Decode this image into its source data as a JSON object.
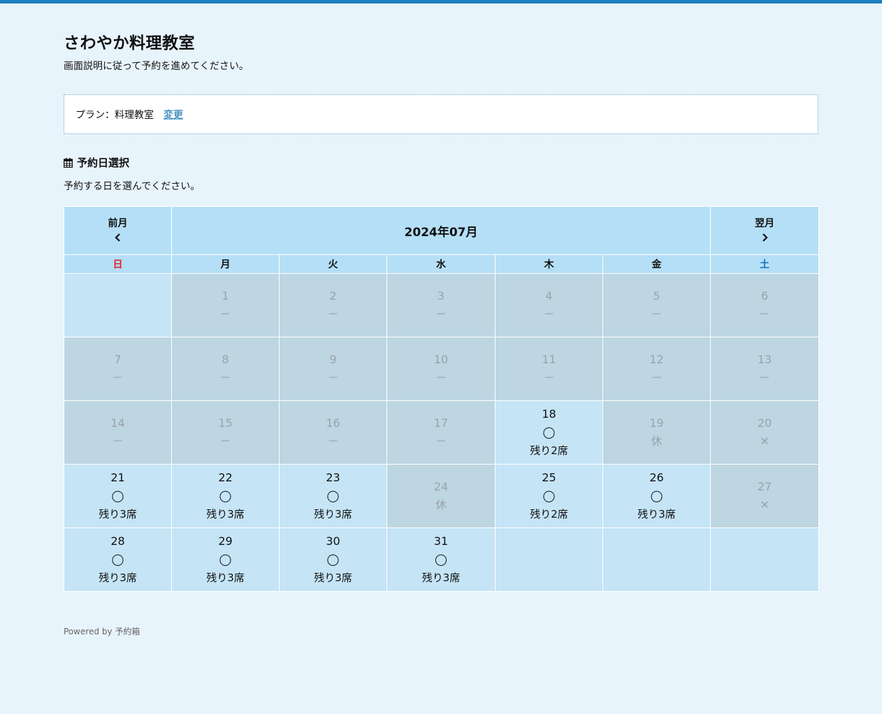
{
  "header": {
    "title": "さわやか料理教室",
    "lead": "画面説明に従って予約を進めてください。"
  },
  "plan": {
    "label": "プラン：料理教室",
    "change_label": "変更"
  },
  "section": {
    "title": "予約日選択",
    "description": "予約する日を選んでください。"
  },
  "calendar": {
    "prev_label": "前月",
    "next_label": "翌月",
    "month_title": "2024年07月",
    "weekdays": [
      "日",
      "月",
      "火",
      "水",
      "木",
      "金",
      "土"
    ],
    "weeks": [
      [
        {
          "day": "",
          "status": "empty"
        },
        {
          "day": "1",
          "mark": "－",
          "status": "off"
        },
        {
          "day": "2",
          "mark": "－",
          "status": "off"
        },
        {
          "day": "3",
          "mark": "－",
          "status": "off"
        },
        {
          "day": "4",
          "mark": "－",
          "status": "off"
        },
        {
          "day": "5",
          "mark": "－",
          "status": "off"
        },
        {
          "day": "6",
          "mark": "－",
          "status": "off"
        }
      ],
      [
        {
          "day": "7",
          "mark": "－",
          "status": "off"
        },
        {
          "day": "8",
          "mark": "－",
          "status": "off"
        },
        {
          "day": "9",
          "mark": "－",
          "status": "off"
        },
        {
          "day": "10",
          "mark": "－",
          "status": "off"
        },
        {
          "day": "11",
          "mark": "－",
          "status": "off"
        },
        {
          "day": "12",
          "mark": "－",
          "status": "off"
        },
        {
          "day": "13",
          "mark": "－",
          "status": "off"
        }
      ],
      [
        {
          "day": "14",
          "mark": "－",
          "status": "off"
        },
        {
          "day": "15",
          "mark": "－",
          "status": "off"
        },
        {
          "day": "16",
          "mark": "－",
          "status": "off"
        },
        {
          "day": "17",
          "mark": "－",
          "status": "off"
        },
        {
          "day": "18",
          "mark": "◯",
          "remaining": "残り2席",
          "status": "open"
        },
        {
          "day": "19",
          "mark": "休",
          "status": "off"
        },
        {
          "day": "20",
          "mark": "✕",
          "status": "off"
        }
      ],
      [
        {
          "day": "21",
          "mark": "◯",
          "remaining": "残り3席",
          "status": "open"
        },
        {
          "day": "22",
          "mark": "◯",
          "remaining": "残り3席",
          "status": "open"
        },
        {
          "day": "23",
          "mark": "◯",
          "remaining": "残り3席",
          "status": "open"
        },
        {
          "day": "24",
          "mark": "休",
          "status": "off"
        },
        {
          "day": "25",
          "mark": "◯",
          "remaining": "残り2席",
          "status": "open"
        },
        {
          "day": "26",
          "mark": "◯",
          "remaining": "残り3席",
          "status": "open"
        },
        {
          "day": "27",
          "mark": "✕",
          "status": "off"
        }
      ],
      [
        {
          "day": "28",
          "mark": "◯",
          "remaining": "残り3席",
          "status": "open"
        },
        {
          "day": "29",
          "mark": "◯",
          "remaining": "残り3席",
          "status": "open"
        },
        {
          "day": "30",
          "mark": "◯",
          "remaining": "残り3席",
          "status": "open"
        },
        {
          "day": "31",
          "mark": "◯",
          "remaining": "残り3席",
          "status": "open"
        },
        {
          "day": "",
          "status": "empty"
        },
        {
          "day": "",
          "status": "empty"
        },
        {
          "day": "",
          "status": "empty"
        }
      ]
    ]
  },
  "footer": {
    "text": "Powered by 予約箱"
  },
  "colors": {
    "accent": "#1a7fc1",
    "page_bg": "#e8f4fc",
    "header_bg": "#b5dff6",
    "open_bg": "#c5e4f6",
    "off_bg": "#bdd6e2",
    "sunday": "#e0202a",
    "saturday": "#1572b8",
    "link": "#4a95c4"
  },
  "icons": {
    "section": "calendar-icon",
    "prev": "chevron-left-icon",
    "next": "chevron-right-icon"
  }
}
